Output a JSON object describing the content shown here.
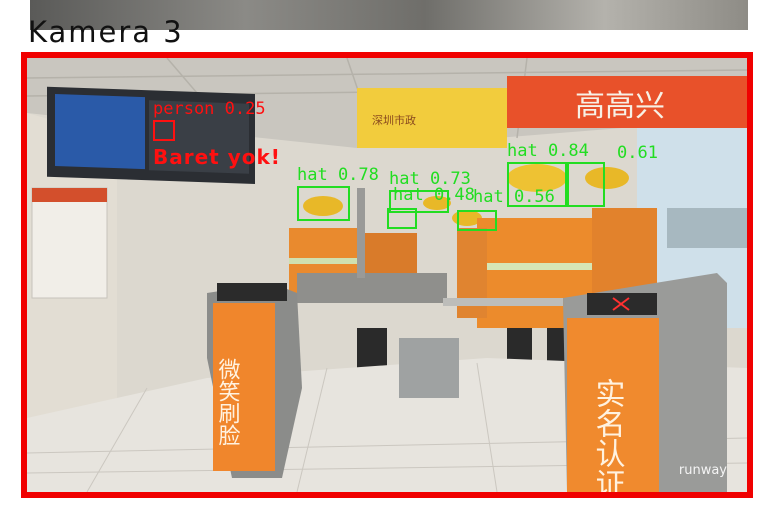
{
  "camera": {
    "title": "Kamera 3"
  },
  "scene": {
    "sign_banner": "高高兴",
    "sign_logo": "深圳市政",
    "left_gate_text": "微笑刷脸",
    "right_gate_text": "实名认证",
    "watermark": "runway"
  },
  "detections": [
    {
      "label": "person 0.25",
      "color": "#ff1010"
    },
    {
      "label": "hat 0.78",
      "color": "#22dd22"
    },
    {
      "label": "hat 0.73",
      "color": "#22dd22"
    },
    {
      "label": "hat 0.48",
      "color": "#22dd22"
    },
    {
      "label": "hat 0.56",
      "color": "#22dd22"
    },
    {
      "label": "hat 0.84",
      "color": "#22dd22"
    },
    {
      "label": "0.61",
      "color": "#22dd22"
    }
  ],
  "alert": {
    "text": "Baret yok!",
    "color": "#ff1010"
  },
  "colors": {
    "frame_border": "#f00000",
    "detection_ok": "#22dd22",
    "detection_alert": "#ff1010"
  }
}
